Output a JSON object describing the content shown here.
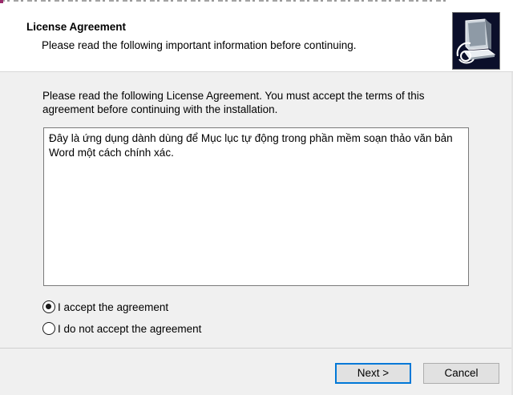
{
  "header": {
    "title": "License Agreement",
    "subtitle": "Please read the following important information before continuing.",
    "logo_icon": "installer-computer-icon"
  },
  "main": {
    "instructions": "Please read the following License Agreement. You must accept the terms of this agreement before continuing with the installation.",
    "license_text": "Đây là ứng dụng dành dùng để Mục lục tự động trong phần mềm soạn thảo văn bản Word một cách chính xác."
  },
  "options": {
    "accept_label": "I accept the agreement",
    "decline_label": "I do not accept the agreement",
    "selected": "accept"
  },
  "buttons": {
    "next_label": "Next >",
    "cancel_label": "Cancel"
  },
  "colors": {
    "accent": "#0078d7",
    "header_bg": "#ffffff",
    "body_bg": "#f0f0f0"
  }
}
